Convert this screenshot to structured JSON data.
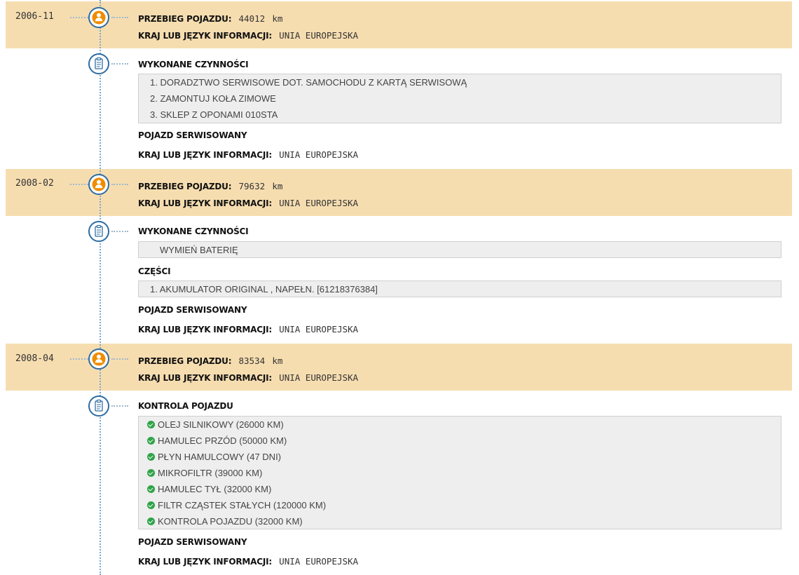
{
  "colors": {
    "band": "#f6ddb0",
    "node_border": "#2e6da4",
    "person_icon": "#f08c00",
    "check": "#2fa34a"
  },
  "labels": {
    "mileage": "PRZEBIEG POJAZDU:",
    "country": "KRAJ LUB JĘZYK INFORMACJI:",
    "unit": "km"
  },
  "entries": [
    {
      "date": "2006-11",
      "mileage": "44012",
      "country": "UNIA EUROPEJSKA",
      "detail": {
        "title": "WYKONANE CZYNNOŚCI",
        "items": [
          "1. DORADZTWO SERWISOWE DOT. SAMOCHODU Z KARTĄ SERWISOWĄ",
          "2. ZAMONTUJ KOŁA ZIMOWE",
          "3. SKLEP Z OPONAMI 010STA"
        ],
        "serviced": "POJAZD SERWISOWANY",
        "country_label": "KRAJ LUB JĘZYK INFORMACJI:",
        "country": "UNIA EUROPEJSKA"
      }
    },
    {
      "date": "2008-02",
      "mileage": "79632",
      "country": "UNIA EUROPEJSKA",
      "detail": {
        "title": "WYKONANE CZYNNOŚCI",
        "items": [
          "WYMIEŃ BATERIĘ"
        ],
        "parts_title": "CZĘŚCI",
        "parts": [
          "1. AKUMULATOR ORIGINAL , NAPEŁN. [61218376384]"
        ],
        "serviced": "POJAZD SERWISOWANY",
        "country_label": "KRAJ LUB JĘZYK INFORMACJI:",
        "country": "UNIA EUROPEJSKA"
      }
    },
    {
      "date": "2008-04",
      "mileage": "83534",
      "country": "UNIA EUROPEJSKA",
      "detail": {
        "title": "KONTROLA POJAZDU",
        "checks": [
          "OLEJ SILNIKOWY (26000 KM)",
          "HAMULEC PRZÓD (50000 KM)",
          "PŁYN HAMULCOWY (47 DNI)",
          "MIKROFILTR (39000 KM)",
          "HAMULEC TYŁ (32000 KM)",
          "FILTR CZĄSTEK STAŁYCH (120000 KM)",
          "KONTROLA POJAZDU (32000 KM)"
        ],
        "serviced": "POJAZD SERWISOWANY",
        "country_label": "KRAJ LUB JĘZYK INFORMACJI:",
        "country": "UNIA EUROPEJSKA"
      }
    }
  ]
}
